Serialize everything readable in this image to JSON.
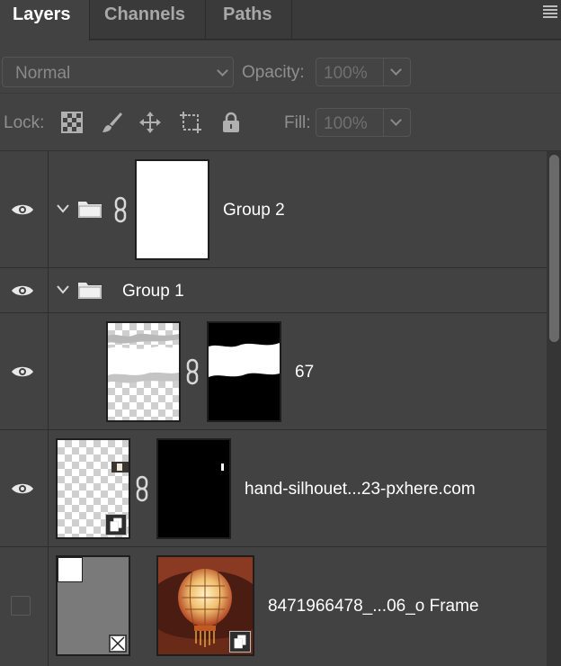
{
  "tabs": [
    {
      "label": "Layers",
      "active": true
    },
    {
      "label": "Channels",
      "active": false
    },
    {
      "label": "Paths",
      "active": false
    }
  ],
  "options": {
    "blend_mode": "Normal",
    "opacity_label": "Opacity:",
    "opacity_value": "100%",
    "lock_label": "Lock:",
    "fill_label": "Fill:",
    "fill_value": "100%"
  },
  "layers": [
    {
      "name": "Group 2",
      "type": "group",
      "expanded": true,
      "visible": true
    },
    {
      "name": "Group 1",
      "type": "group",
      "expanded": true,
      "visible": true
    },
    {
      "name": "67",
      "type": "layer-with-mask",
      "visible": true
    },
    {
      "name": "hand-silhouet...23-pxhere.com",
      "type": "smart-object-with-mask",
      "visible": true
    },
    {
      "name": "8471966478_...06_o Frame",
      "type": "frame",
      "visible": false
    }
  ],
  "colors": {
    "panel_bg": "#424242",
    "tab_bar_bg": "#3a3a3a",
    "text_primary": "#ffffff",
    "text_dim": "#8f8f8f"
  }
}
